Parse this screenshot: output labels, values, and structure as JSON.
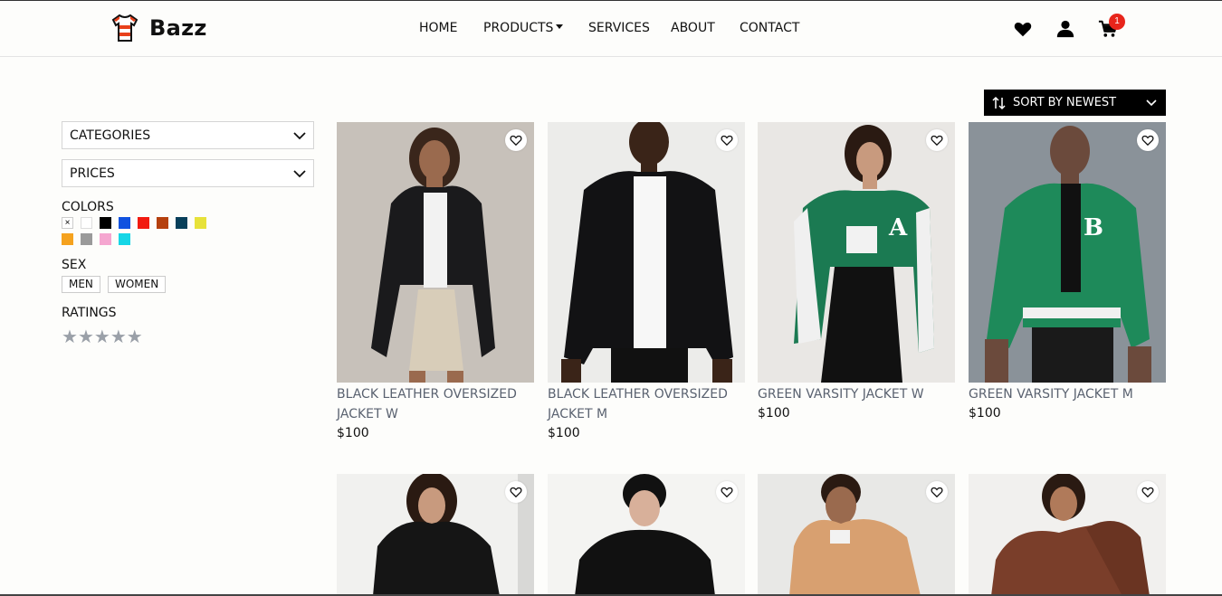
{
  "brand": {
    "name": "Bazz"
  },
  "nav": {
    "items": [
      {
        "label": "HOME"
      },
      {
        "label": "PRODUCTS"
      },
      {
        "label": "SERVICES"
      },
      {
        "label": "ABOUT"
      },
      {
        "label": "CONTACT"
      }
    ]
  },
  "header_icons": {
    "wishlist": "heart-icon",
    "account": "user-icon",
    "cart": "cart-icon",
    "cart_count": "1"
  },
  "sort": {
    "label": "SORT BY NEWEST"
  },
  "filters": {
    "categories_label": "CATEGORIES",
    "prices_label": "PRICES",
    "colors_label": "COLORS",
    "colors_clear": "×",
    "colors": [
      "#ffffff",
      "#000000",
      "#1152e0",
      "#f21a10",
      "#b5400e",
      "#073f5a",
      "#e7e23a",
      "#f5a21e",
      "#9a9a9a",
      "#f5a6d0",
      "#16d6e6"
    ],
    "sex_label": "SEX",
    "sex_options": [
      "MEN",
      "WOMEN"
    ],
    "ratings_label": "RATINGS",
    "stars": [
      "★",
      "★",
      "★",
      "★",
      "★"
    ]
  },
  "products": [
    {
      "name": "BLACK LEATHER OVERSIZED JACKET W",
      "price": "$100"
    },
    {
      "name": "BLACK LEATHER OVERSIZED JACKET M",
      "price": "$100"
    },
    {
      "name": "GREEN VARSITY JACKET W",
      "price": "$100"
    },
    {
      "name": "GREEN VARSITY JACKET M",
      "price": "$100"
    },
    {
      "name": "",
      "price": ""
    },
    {
      "name": "",
      "price": ""
    },
    {
      "name": "",
      "price": ""
    },
    {
      "name": "",
      "price": ""
    }
  ],
  "colors": {
    "accent": "#000000",
    "badge": "#e8251b",
    "product_name": "#5a6270"
  }
}
